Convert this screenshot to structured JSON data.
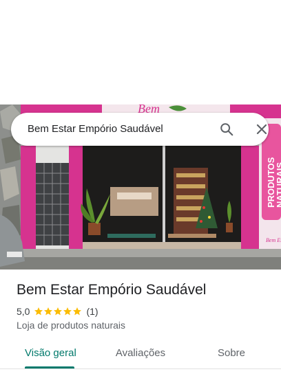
{
  "search": {
    "query": "Bem Estar Empório Saudável"
  },
  "photo": {
    "sign_text": "Bem",
    "banner_lines": [
      "PRODUTOS",
      "NATURAIS"
    ],
    "sticker_text": "Bem Estar"
  },
  "place": {
    "name": "Bem Estar Empório Saudável",
    "rating": "5,0",
    "stars": 5,
    "review_count": "(1)",
    "category": "Loja de produtos naturais"
  },
  "tabs": [
    {
      "label": "Visão geral",
      "active": true
    },
    {
      "label": "Avaliações",
      "active": false
    },
    {
      "label": "Sobre",
      "active": false
    }
  ],
  "colors": {
    "accent": "#00796b",
    "star": "#fbbc04",
    "storefront_pink": "#d6338f",
    "banner_pink": "#e8559e"
  },
  "icons": {
    "search": "search-icon",
    "close": "close-icon",
    "star": "star-icon"
  }
}
